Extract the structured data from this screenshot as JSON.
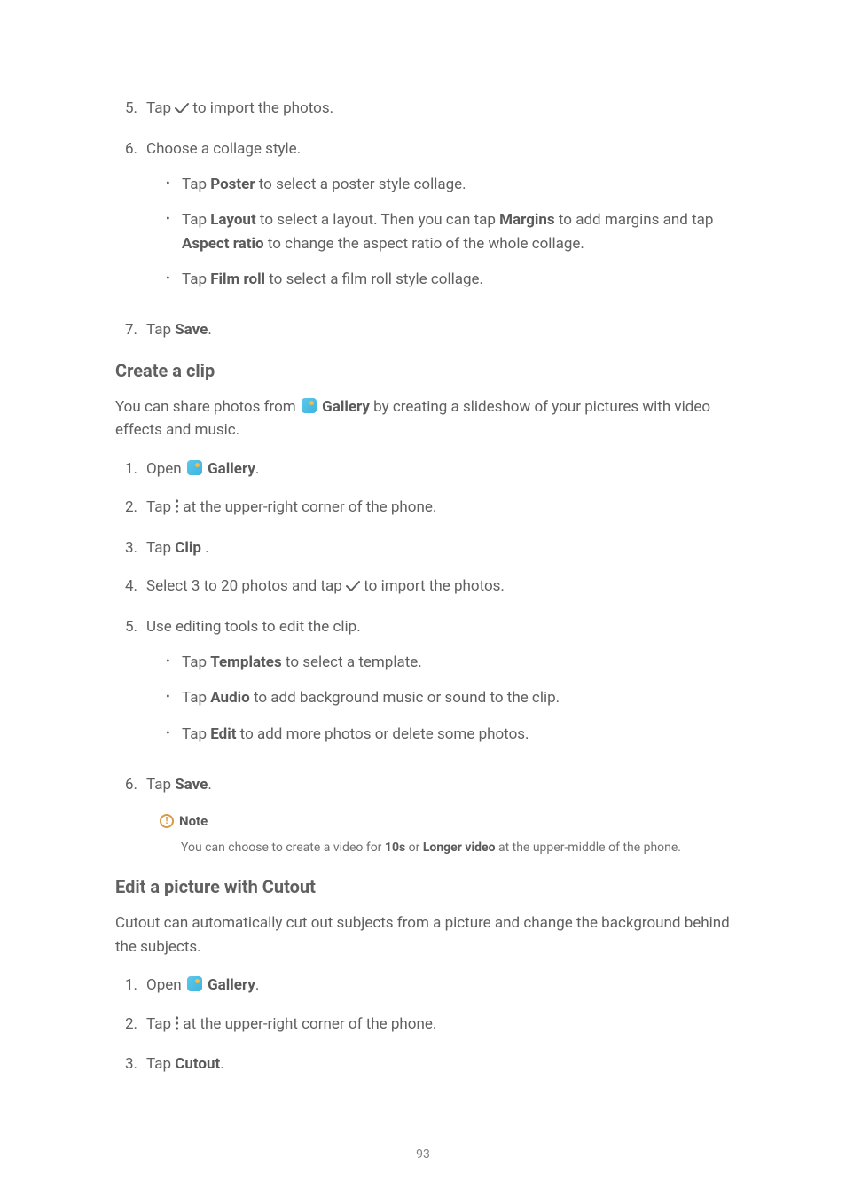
{
  "s1": {
    "li5": {
      "num": "5.",
      "t1": "Tap ",
      "t2": " to import the photos."
    },
    "li6": {
      "num": "6.",
      "t": "Choose a collage style.",
      "b1": {
        "t1": "Tap ",
        "bold": "Poster",
        "t2": " to select a poster style collage."
      },
      "b2": {
        "t1": "Tap ",
        "bold1": "Layout",
        "t2": " to select a layout. Then you can tap ",
        "bold2": "Margins",
        "t3": " to add margins and tap ",
        "bold3": "Aspect ratio",
        "t4": " to change the aspect ratio of the whole collage."
      },
      "b3": {
        "t1": "Tap ",
        "bold": "Film roll",
        "t2": " to select a film roll style collage."
      }
    },
    "li7": {
      "num": "7.",
      "t1": "Tap ",
      "bold": "Save",
      "t2": "."
    }
  },
  "h1": "Create a clip",
  "p1": {
    "t1": "You can share photos from ",
    "bold": "Gallery",
    "t2": " by creating a slideshow of your pictures with video effects and music."
  },
  "s2": {
    "li1": {
      "num": "1.",
      "t1": "Open ",
      "bold": "Gallery",
      "t2": "."
    },
    "li2": {
      "num": "2.",
      "t1": "Tap ",
      "t2": " at the upper-right corner of the phone."
    },
    "li3": {
      "num": "3.",
      "t1": "Tap ",
      "bold": "Clip",
      "t2": " ."
    },
    "li4": {
      "num": "4.",
      "t1": "Select 3 to 20 photos and tap ",
      "t2": " to import the photos."
    },
    "li5": {
      "num": "5.",
      "t": "Use editing tools to edit the clip.",
      "b1": {
        "t1": "Tap ",
        "bold": "Templates",
        "t2": " to select a template."
      },
      "b2": {
        "t1": "Tap ",
        "bold": "Audio",
        "t2": " to add background music or sound to the clip."
      },
      "b3": {
        "t1": "Tap ",
        "bold": "Edit",
        "t2": " to add more photos or delete some photos."
      }
    },
    "li6": {
      "num": "6.",
      "t1": "Tap ",
      "bold": "Save",
      "t2": "."
    }
  },
  "note": {
    "label": "Note",
    "t1": "You can choose to create a video for ",
    "bold1": "10s",
    "t2": " or ",
    "bold2": "Longer video",
    "t3": " at the upper-middle of the phone."
  },
  "h2": "Edit a picture with Cutout",
  "p2": "Cutout can automatically cut out subjects from a picture and change the background behind the subjects.",
  "s3": {
    "li1": {
      "num": "1.",
      "t1": "Open ",
      "bold": "Gallery",
      "t2": "."
    },
    "li2": {
      "num": "2.",
      "t1": "Tap ",
      "t2": " at the upper-right corner of the phone."
    },
    "li3": {
      "num": "3.",
      "t1": "Tap ",
      "bold": "Cutout",
      "t2": "."
    }
  },
  "pageNumber": "93"
}
